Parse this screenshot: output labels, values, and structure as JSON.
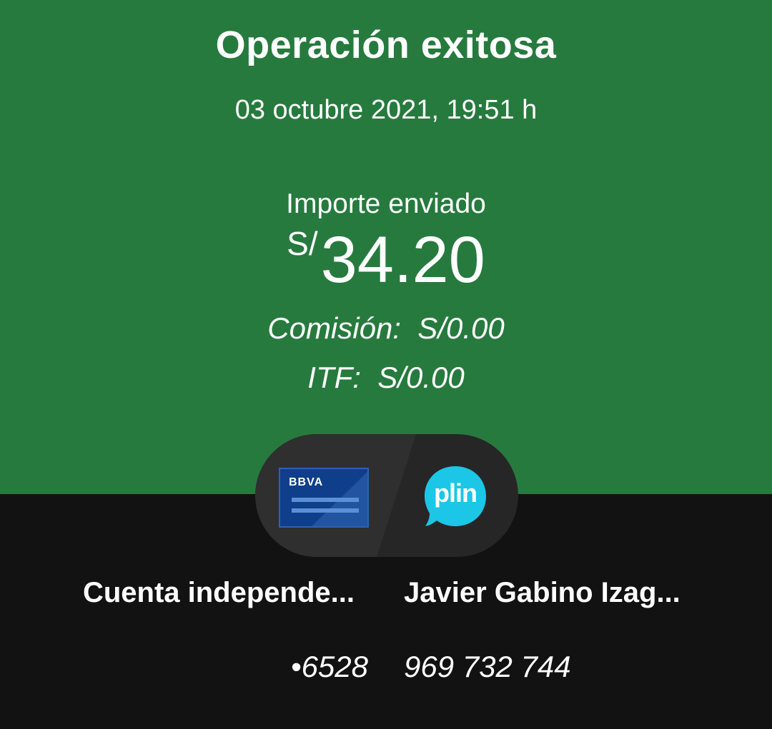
{
  "header": {
    "title": "Operación exitosa",
    "datetime": "03 octubre 2021, 19:51 h"
  },
  "amount": {
    "label": "Importe enviado",
    "currency": "S/",
    "value": "34.20"
  },
  "fees": {
    "commission": "Comisión:  S/0.00",
    "itf": "ITF:  S/0.00"
  },
  "transfer": {
    "origin_brand": "BBVA",
    "destination_brand": "plin",
    "origin_name": "Cuenta independe...",
    "origin_account": "•6528",
    "destination_name": "Javier Gabino Izag...",
    "destination_phone": "969 732 744"
  },
  "colors": {
    "header_bg": "#267a3d",
    "page_bg": "#121212",
    "bbva_card": "#0f3f8a",
    "plin_bubble": "#1cc6e6"
  },
  "icons": {
    "origin": "bbva-card-icon",
    "destination": "plin-logo-icon"
  }
}
